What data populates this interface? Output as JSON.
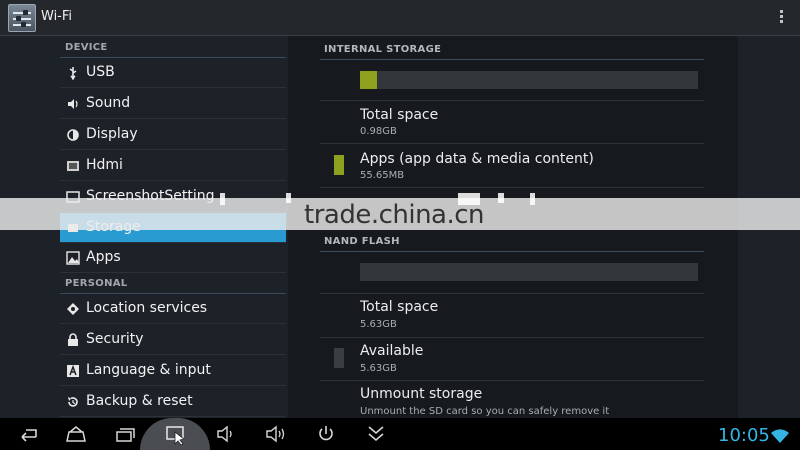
{
  "window": {
    "title": "Wi-Fi"
  },
  "menu": {
    "sections": [
      {
        "label": "DEVICE"
      },
      {
        "label": "PERSONAL"
      }
    ],
    "items": [
      {
        "label": "USB",
        "icon": "usb-icon"
      },
      {
        "label": "Sound",
        "icon": "speaker-icon"
      },
      {
        "label": "Display",
        "icon": "brightness-icon"
      },
      {
        "label": "Hdmi",
        "icon": "hdmi-icon"
      },
      {
        "label": "ScreenshotSetting",
        "icon": "screenshot-icon"
      },
      {
        "label": "Storage",
        "icon": "storage-icon",
        "selected": true
      },
      {
        "label": "Apps",
        "icon": "apps-icon"
      },
      {
        "label": "Location services",
        "icon": "location-icon"
      },
      {
        "label": "Security",
        "icon": "lock-icon"
      },
      {
        "label": "Language & input",
        "icon": "keyboard-icon"
      },
      {
        "label": "Backup & reset",
        "icon": "backup-icon"
      }
    ]
  },
  "storage": {
    "internal": {
      "header": "INTERNAL STORAGE",
      "usage_fraction": 0.05,
      "total_title": "Total space",
      "total_value": "0.98GB",
      "apps_title": "Apps (app data & media content)",
      "apps_value": "55.65MB"
    },
    "nand": {
      "header": "NAND FLASH",
      "usage_fraction": 0.0,
      "total_title": "Total space",
      "total_value": "5.63GB",
      "available_title": "Available",
      "available_value": "5.63GB",
      "unmount_title": "Unmount storage",
      "unmount_summary": "Unmount the SD card so you can safely remove it"
    }
  },
  "status": {
    "clock": "10:05"
  },
  "watermark": {
    "text": "trade.china.cn"
  },
  "colors": {
    "accent": "#2a9bd0",
    "apps_swatch": "#8ea11f",
    "available_swatch": "#3a3e43",
    "clock": "#35b5e5"
  }
}
